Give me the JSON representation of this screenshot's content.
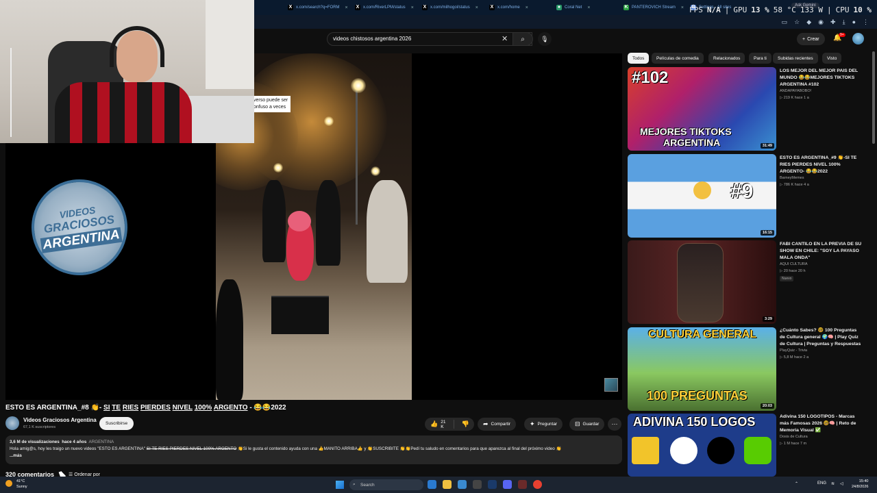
{
  "browser": {
    "tabs": [
      {
        "label": "x.com/search?q=FORM",
        "icon": "x-logo-icon"
      },
      {
        "label": "x.com/RiverLPM/status",
        "icon": "x-logo-icon"
      },
      {
        "label": "x.com/milhogol/status",
        "icon": "x-logo-icon"
      },
      {
        "label": "x.com/home",
        "icon": "x-logo-icon"
      },
      {
        "label": "Coral Net",
        "icon": "coral-icon"
      },
      {
        "label": "PANTEROVICH Stream",
        "icon": "twitch-icon"
      },
      {
        "label": "Settings - All sites",
        "icon": "gear-icon"
      }
    ],
    "ask_gemini": "Ask Gemini",
    "overlay": {
      "fps_label": "FPS",
      "fps_value": "N/A",
      "gpu_label": "GPU",
      "gpu_value": "13 %",
      "gpu_temp": "58 °C",
      "gpu_power": "133 W",
      "cpu_label": "CPU",
      "cpu_value": "10 %"
    }
  },
  "youtube": {
    "search": {
      "query": "videos chistosos argentina 2026",
      "placeholder": "Buscar"
    },
    "create_label": "Crear",
    "notif_count": "9+"
  },
  "player": {
    "caption_line1": "verso puede ser",
    "caption_line2": "onfuso a veces",
    "logo_line1": "VIDEOS",
    "logo_line2": "GRACIOSOS",
    "logo_line3": "ARGENTINA"
  },
  "video": {
    "title_prefix": "ESTO ES ARGENTINA_#8 👏-",
    "title_words": [
      "SI",
      "TE",
      "RIES",
      "PIERDES",
      "NIVEL",
      "100%",
      "ARGENTO"
    ],
    "title_suffix": "- 😂😂2022",
    "channel": "Videos Graciosos Argentina",
    "subscribers": "67,1 K suscriptores",
    "subscribe": "Suscribirse",
    "likes": "21 K",
    "share": "Compartir",
    "ask": "Preguntar",
    "save": "Guardar",
    "views": "3,6 M de visualizaciones",
    "age": "hace 4 años",
    "tag": "ARGENTINA",
    "desc_a": "Hola amig@s, hoy les traigo un nuevo videos \"ESTO ES ARGENTINA\"",
    "desc_strike": "SI TE RIES PIERDES NIVEL 100% ARGENTO",
    "desc_b": "👏Si le gusta el contenido ayuda con una 👍MANITO ARRIBA👍 y 👏SUSCRIBITE 👏👏Pedí tu saludo en comentarios para que aparezca al final del próximo video 👏",
    "more": "...más",
    "comments": "320 comentarios",
    "sort": "Ordenar por"
  },
  "chips": [
    "Todos",
    "Películas de comedia",
    "Relacionados",
    "Para ti",
    "Subidas recientes",
    "Visto"
  ],
  "recommendations": [
    {
      "title": "LOS MEJOR DEL MEJOR PAIS DEL MUNDO 😂😂MEJORES TIKTOKS ARGENTINA #102",
      "channel": "ANDAPAYABOBO!",
      "meta": "▷ 219 K  hace 1 a",
      "duration": "31:49",
      "overlay_top": "#102",
      "overlay_bottom1": "MEJORES TIKTOKS",
      "overlay_bottom2": "ARGENTINA"
    },
    {
      "title": "ESTO ES ARGENTINA_#9 👏-SI TE RIES PIERDES NIVEL 100% ARGENTO- 😂😂2022",
      "channel": "BarneyMemes",
      "meta": "▷ 786 K  hace 4 a",
      "duration": "16:15",
      "overlay_top": "#9"
    },
    {
      "title": "FABI CANTILO EN LA PREVIA DE SU SHOW EN CHILE: \"SOY LA PAYASO MALA ONDA\"",
      "channel": "AQUI CULTURA",
      "meta": "▷ 20  hace 20 h",
      "badge": "Nuevo",
      "duration": "3:29"
    },
    {
      "title": "¿Cuánto Sabes? 🤓 100 Preguntas de Cultura general 🌍🧠 | Play Quiz de Cultura | Preguntas y Respuestas",
      "channel": "PlayQuiz - Trivia",
      "meta": "▷ 5,8 M  hace 2 a",
      "duration": "20:03",
      "overlay_top": "CULTURA GENERAL",
      "overlay_bottom1": "100 PREGUNTAS"
    },
    {
      "title": "Adivina 150 LOGOTIPOS - Marcas más Famosas 2026 🤓🧠 | Reto de Memoria Visual ✅",
      "channel": "Dosis de Cultura",
      "meta": "▷ 1 M  hace 7 m",
      "overlay_top": "ADIVINA 150 LOGOS"
    }
  ],
  "taskbar": {
    "temp": "41°C",
    "weather": "Sunny",
    "search": "Search",
    "lang": "ENG",
    "time": "15:40",
    "date": "24/8/2026"
  }
}
